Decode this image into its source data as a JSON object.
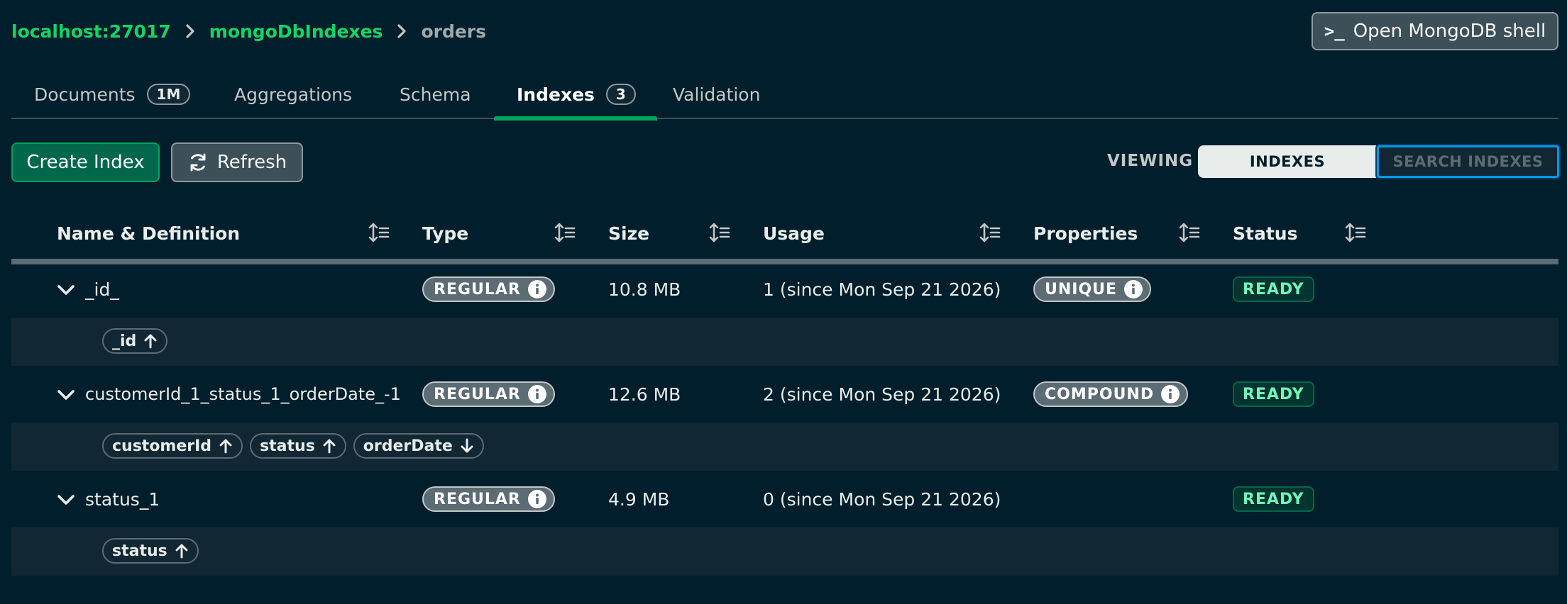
{
  "breadcrumb": {
    "host": "localhost:27017",
    "database": "mongoDbIndexes",
    "collection": "orders"
  },
  "shell_button": {
    "icon": ">_",
    "label": "Open MongoDB shell"
  },
  "tabs": [
    {
      "label": "Documents",
      "count": "1M"
    },
    {
      "label": "Aggregations"
    },
    {
      "label": "Schema"
    },
    {
      "label": "Indexes",
      "count": "3",
      "active": true
    },
    {
      "label": "Validation"
    }
  ],
  "toolbar": {
    "create_label": "Create Index",
    "refresh_label": "Refresh",
    "viewing_label": "VIEWING",
    "view_indexes": "INDEXES",
    "view_search_indexes": "SEARCH INDEXES"
  },
  "table": {
    "columns": [
      "Name & Definition",
      "Type",
      "Size",
      "Usage",
      "Properties",
      "Status"
    ],
    "rows": [
      {
        "name": "_id_",
        "type": "REGULAR",
        "size": "10.8 MB",
        "usage": "1 (since Mon Sep 21 2026)",
        "property": "UNIQUE",
        "status": "READY",
        "keys": [
          {
            "field": "_id",
            "direction": "asc"
          }
        ]
      },
      {
        "name": "customerId_1_status_1_orderDate_-1",
        "type": "REGULAR",
        "size": "12.6 MB",
        "usage": "2 (since Mon Sep 21 2026)",
        "property": "COMPOUND",
        "status": "READY",
        "keys": [
          {
            "field": "customerId",
            "direction": "asc"
          },
          {
            "field": "status",
            "direction": "asc"
          },
          {
            "field": "orderDate",
            "direction": "desc"
          }
        ]
      },
      {
        "name": "status_1",
        "type": "REGULAR",
        "size": "4.9 MB",
        "usage": "0 (since Mon Sep 21 2026)",
        "property": "",
        "status": "READY",
        "keys": [
          {
            "field": "status",
            "direction": "asc"
          }
        ]
      }
    ]
  },
  "colors": {
    "background": "#001e2b",
    "accent_green": "#00a35c",
    "link_green": "#13d468",
    "ready_text": "#71f6ba",
    "focus_blue": "#0498ec"
  },
  "icons": {
    "breadcrumb_separator": "chevron-right-icon",
    "refresh": "refresh-icon",
    "sort": "sort-icon",
    "expand": "chevron-down-icon",
    "info": "info-icon",
    "key_asc": "arrow-up-icon",
    "key_desc": "arrow-down-icon"
  }
}
